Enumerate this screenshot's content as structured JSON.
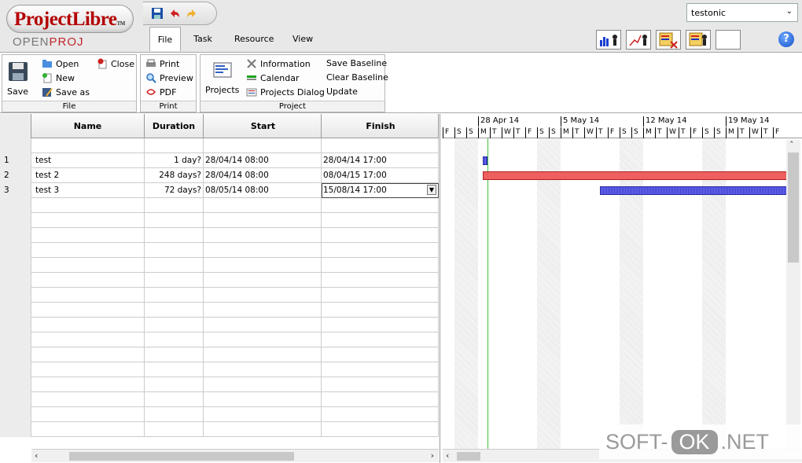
{
  "app": {
    "logo_title": "ProjectLibre",
    "logo_tm": "TM",
    "logo_sub_a": "OPEN",
    "logo_sub_b": "PROJ"
  },
  "user": {
    "selected": "testonic"
  },
  "tabs": [
    {
      "label": "File",
      "active": true
    },
    {
      "label": "Task",
      "active": false
    },
    {
      "label": "Resource",
      "active": false
    },
    {
      "label": "View",
      "active": false
    }
  ],
  "ribbon": {
    "file": {
      "label": "File",
      "save": "Save",
      "open": "Open",
      "new": "New",
      "save_as": "Save as",
      "close": "Close"
    },
    "print": {
      "label": "Print",
      "print": "Print",
      "preview": "Preview",
      "pdf": "PDF"
    },
    "project": {
      "label": "Project",
      "projects": "Projects",
      "information": "Information",
      "calendar": "Calendar",
      "projects_dialog": "Projects Dialog",
      "save_baseline": "Save Baseline",
      "clear_baseline": "Clear Baseline",
      "update": "Update"
    }
  },
  "table": {
    "columns": [
      "",
      "Name",
      "Duration",
      "Start",
      "Finish"
    ],
    "rows": [
      {
        "id": "",
        "name": "",
        "duration": "",
        "start": "",
        "finish": ""
      },
      {
        "id": "1",
        "name": "test",
        "duration": "1 day?",
        "start": "28/04/14 08:00",
        "finish": "28/04/14 17:00"
      },
      {
        "id": "2",
        "name": "test 2",
        "duration": "248 days?",
        "start": "28/04/14 08:00",
        "finish": "08/04/15 17:00"
      },
      {
        "id": "3",
        "name": "test 3",
        "duration": "72 days?",
        "start": "08/05/14 08:00",
        "finish": "15/08/14 17:00"
      }
    ]
  },
  "gantt": {
    "weeks": [
      "28 Apr 14",
      "5 May 14",
      "12 May 14",
      "19 May 14"
    ],
    "days": [
      "F",
      "S",
      "S",
      "M",
      "T",
      "W",
      "T",
      "F",
      "S",
      "S",
      "M",
      "T",
      "W",
      "T",
      "F",
      "S",
      "S",
      "M",
      "T",
      "W",
      "T",
      "F",
      "S",
      "S",
      "M",
      "T",
      "W",
      "T",
      "F"
    ]
  },
  "watermark": {
    "a": "SOFT-",
    "b": "OK",
    "c": ".NET"
  },
  "colors": {
    "task_bar": "#4040d8",
    "critical_bar": "#ee6060",
    "today_line": "#40c040",
    "logo_red": "#b30000"
  }
}
